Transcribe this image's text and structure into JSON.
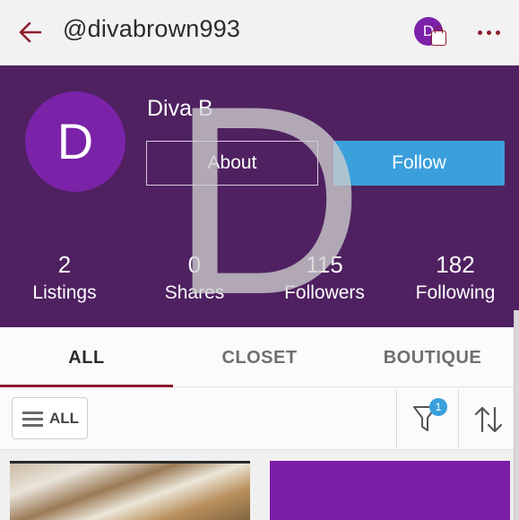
{
  "topbar": {
    "handle": "@divabrown993",
    "back_icon": "arrow-left-icon",
    "avatar_letter": "D",
    "more_icon": "more-dots-icon"
  },
  "profile": {
    "avatar_letter": "D",
    "name": "Diva B",
    "about_label": "About",
    "follow_label": "Follow",
    "watermark_letter": "D"
  },
  "stats": [
    {
      "value": "2",
      "label": "Listings"
    },
    {
      "value": "0",
      "label": "Shares"
    },
    {
      "value": "115",
      "label": "Followers"
    },
    {
      "value": "182",
      "label": "Following"
    }
  ],
  "tabs": [
    {
      "label": "ALL",
      "active": true
    },
    {
      "label": "CLOSET",
      "active": false
    },
    {
      "label": "BOUTIQUE",
      "active": false
    }
  ],
  "filters": {
    "all_label": "ALL",
    "filter_count": "1",
    "filter_icon": "funnel-icon",
    "sort_icon": "sort-arrows-icon"
  },
  "colors": {
    "header_bg": "#4f2160",
    "accent": "#8c1d2e",
    "follow_blue": "#3b9fdc",
    "avatar_purple": "#7a23a8"
  }
}
